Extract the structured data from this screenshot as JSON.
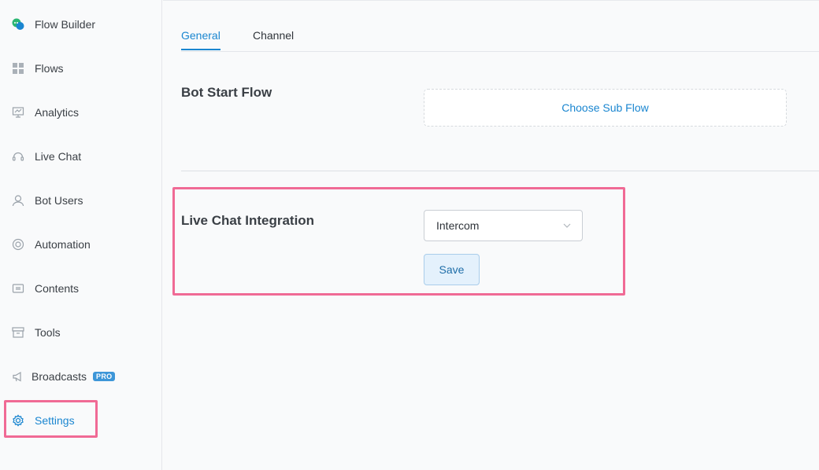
{
  "sidebar": {
    "items": [
      {
        "label": "Flow Builder",
        "icon": "chat-bubbles-icon"
      },
      {
        "label": "Flows",
        "icon": "grid-icon"
      },
      {
        "label": "Analytics",
        "icon": "presentation-board-icon"
      },
      {
        "label": "Live Chat",
        "icon": "headset-icon"
      },
      {
        "label": "Bot Users",
        "icon": "user-icon"
      },
      {
        "label": "Automation",
        "icon": "lifebuoy-icon"
      },
      {
        "label": "Contents",
        "icon": "contents-icon"
      },
      {
        "label": "Tools",
        "icon": "archive-box-icon"
      },
      {
        "label": "Broadcasts",
        "icon": "megaphone-icon",
        "badge": "PRO"
      },
      {
        "label": "Settings",
        "icon": "gear-icon",
        "active": true
      }
    ]
  },
  "tabs": [
    {
      "label": "General",
      "active": true
    },
    {
      "label": "Channel",
      "active": false
    }
  ],
  "bot_start_flow": {
    "title": "Bot Start Flow",
    "button_label": "Choose Sub Flow"
  },
  "live_chat_integration": {
    "title": "Live Chat Integration",
    "selected_value": "Intercom",
    "save_label": "Save"
  },
  "colors": {
    "accent": "#1a86d0",
    "highlight": "#f06a95",
    "pro_badge": "#3d96d8"
  }
}
